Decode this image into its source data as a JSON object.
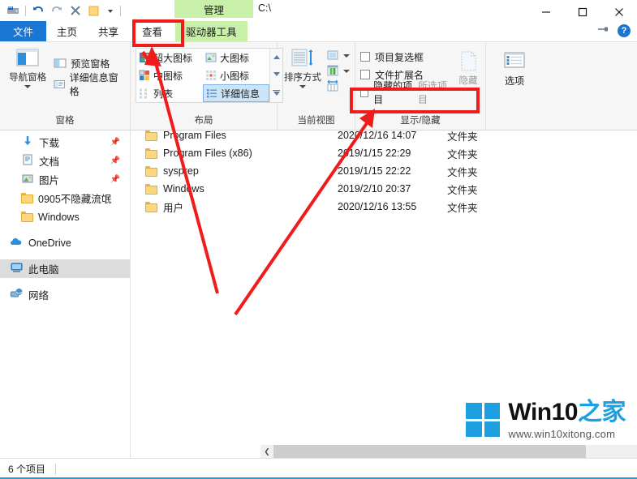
{
  "window": {
    "title": "C:\\",
    "contextual_tab": "管理",
    "controls": {
      "minimize": "—",
      "maximize": "▢",
      "close": "✕"
    },
    "quick_access": [
      "drive-icon",
      "undo-icon",
      "redo-icon",
      "delete-icon",
      "folder-icon",
      "dropdown-icon"
    ]
  },
  "tabs": [
    {
      "label": "文件",
      "name": "tab-file",
      "state": "file"
    },
    {
      "label": "主页",
      "name": "tab-home",
      "state": "normal"
    },
    {
      "label": "共享",
      "name": "tab-share",
      "state": "normal"
    },
    {
      "label": "查看",
      "name": "tab-view",
      "state": "active"
    },
    {
      "label": "驱动器工具",
      "name": "tab-drive-tools",
      "state": "contextual"
    }
  ],
  "tabstrip_right": {
    "pin": "pin-icon",
    "help": "?"
  },
  "ribbon": {
    "groups": [
      {
        "title": "窗格",
        "name": "group-panes",
        "big_button": {
          "label": "导航窗格",
          "has_dropdown": true
        },
        "small_buttons": [
          {
            "label": "预览窗格"
          },
          {
            "label": "详细信息窗格"
          }
        ]
      },
      {
        "title": "布局",
        "name": "group-layout",
        "items": [
          {
            "label": "超大图标",
            "selected": false
          },
          {
            "label": "大图标",
            "selected": false
          },
          {
            "label": "中图标",
            "selected": false
          },
          {
            "label": "小图标",
            "selected": false
          },
          {
            "label": "列表",
            "selected": false
          },
          {
            "label": "详细信息",
            "selected": true
          }
        ]
      },
      {
        "title": "当前视图",
        "name": "group-current-view",
        "big_button": {
          "label": "排序方式",
          "has_dropdown": true
        },
        "side_buttons": [
          "add-columns-icon",
          "size-columns-icon",
          "fit-columns-icon"
        ]
      },
      {
        "title": "显示/隐藏",
        "name": "group-show-hide",
        "checkboxes": [
          {
            "label": "项目复选框",
            "checked": false
          },
          {
            "label": "文件扩展名",
            "checked": false
          },
          {
            "label": "隐藏的项目",
            "checked": false
          }
        ],
        "hide_button": {
          "label": "隐藏",
          "sublabel": "所选项目"
        }
      },
      {
        "title": "",
        "name": "group-options",
        "options_button": {
          "label": "选项"
        }
      }
    ]
  },
  "navigation": {
    "items": [
      {
        "label": "下载",
        "icon": "download-icon",
        "pinned": true,
        "level": 2,
        "selected": false
      },
      {
        "label": "文档",
        "icon": "document-icon",
        "pinned": true,
        "level": 2,
        "selected": false
      },
      {
        "label": "图片",
        "icon": "pictures-icon",
        "pinned": true,
        "level": 2,
        "selected": false
      },
      {
        "label": "0905不隐藏流氓",
        "icon": "folder-icon",
        "pinned": false,
        "level": 2,
        "selected": false
      },
      {
        "label": "Windows",
        "icon": "folder-icon",
        "pinned": false,
        "level": 2,
        "selected": false
      },
      {
        "label": "OneDrive",
        "icon": "onedrive-icon",
        "pinned": false,
        "level": 1,
        "selected": false
      },
      {
        "label": "此电脑",
        "icon": "this-pc-icon",
        "pinned": false,
        "level": 1,
        "selected": true
      },
      {
        "label": "网络",
        "icon": "network-icon",
        "pinned": false,
        "level": 1,
        "selected": false
      }
    ]
  },
  "file_list": {
    "rows": [
      {
        "name": "Program Files",
        "date": "2020/12/16 14:07",
        "type": "文件夹"
      },
      {
        "name": "Program Files (x86)",
        "date": "2019/1/15 22:29",
        "type": "文件夹"
      },
      {
        "name": "sysprep",
        "date": "2019/1/15 22:22",
        "type": "文件夹"
      },
      {
        "name": "Windows",
        "date": "2019/2/10 20:37",
        "type": "文件夹"
      },
      {
        "name": "用户",
        "date": "2020/12/16 13:55",
        "type": "文件夹"
      }
    ]
  },
  "status": {
    "item_count": "6 个项目"
  },
  "watermark": {
    "brand_en": "Win10",
    "brand_zh": "之家",
    "url": "www.win10xitong.com"
  },
  "annotations": {
    "accent_color": "#f01c1c",
    "boxes": [
      {
        "name": "highlight-view-tab",
        "target": "查看"
      },
      {
        "name": "highlight-hidden-items",
        "target": "隐藏的项目 所选项目"
      }
    ],
    "arrows": [
      {
        "name": "arrow-to-view-tab"
      },
      {
        "name": "arrow-to-hidden-items"
      }
    ]
  }
}
